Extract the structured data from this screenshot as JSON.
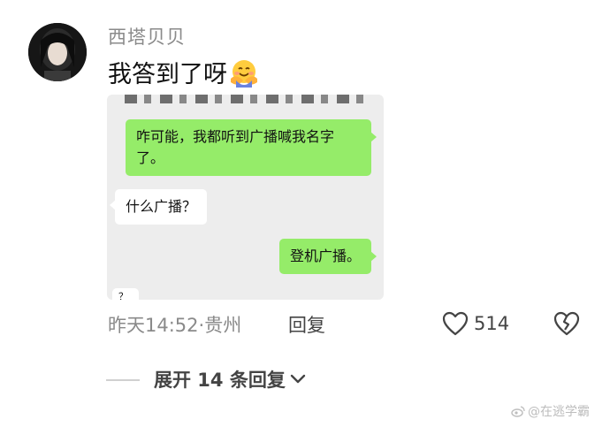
{
  "comment": {
    "username": "西塔贝贝",
    "text": "我答到了呀",
    "emoji_icon": "hugging-face-emoji",
    "screenshot": {
      "messages": [
        {
          "side": "right",
          "text": "咋可能，我都听到广播喊我名字了。"
        },
        {
          "side": "left",
          "text": "什么广播？"
        },
        {
          "side": "right",
          "text": "登机广播。"
        },
        {
          "side": "left",
          "text": "？"
        }
      ],
      "colors": {
        "sent_bubble": "#95ec69",
        "received_bubble": "#ffffff",
        "chat_bg": "#ededed"
      }
    },
    "meta": "昨天14:52·贵州",
    "reply_label": "回复",
    "like_count": "514",
    "expand_label": "展开 14 条回复",
    "watermark": "@在逃学霸"
  }
}
